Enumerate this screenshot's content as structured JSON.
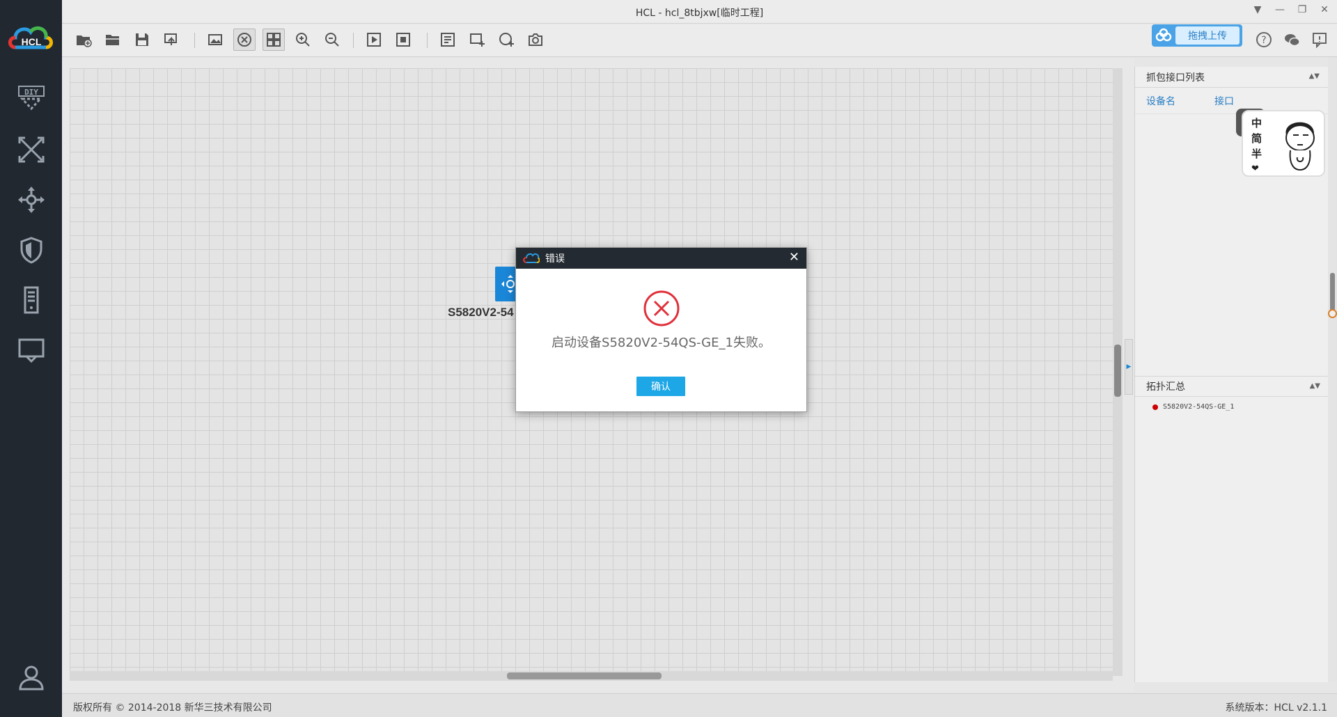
{
  "window": {
    "title": "HCL - hcl_8tbjxw[临时工程]"
  },
  "logo": {
    "text": "HCL"
  },
  "rail": {
    "items": [
      "diy-icon",
      "network-icon",
      "routing-icon",
      "shield-icon",
      "server-icon",
      "monitor-icon"
    ],
    "user": "user-icon"
  },
  "toolbar": {
    "upload_label": "拖拽上传"
  },
  "canvas": {
    "device_label": "S5820V2-54"
  },
  "right_panel": {
    "capture_title": "抓包接口列表",
    "col_device": "设备名",
    "col_interface": "接口",
    "topo_title": "拓扑汇总",
    "topo_items": [
      "S5820V2-54QS-GE_1"
    ],
    "sticker_text": [
      "中",
      "简",
      "半"
    ]
  },
  "status": {
    "copyright": "版权所有 © 2014-2018 新华三技术有限公司",
    "version": "系统版本：HCL v2.1.1"
  },
  "dialog": {
    "title": "错误",
    "message": "启动设备S5820V2-54QS-GE_1失败。",
    "ok": "确认"
  },
  "colors": {
    "rail_bg": "#212830",
    "accent": "#1ea7e6",
    "error": "#e0303a",
    "device": "#1a86d8"
  }
}
